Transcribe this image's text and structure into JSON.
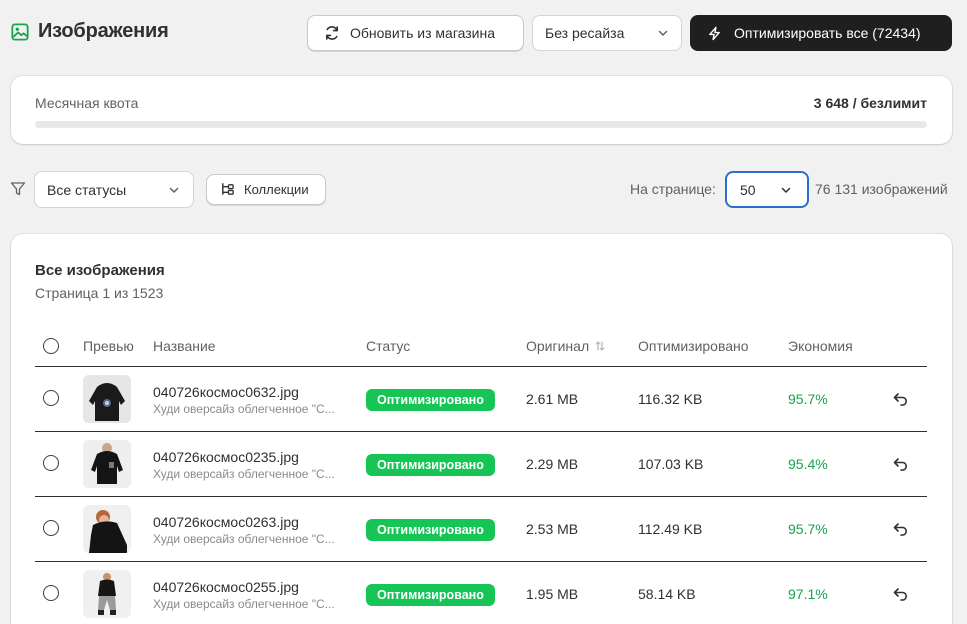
{
  "header": {
    "title": "Изображения",
    "refresh_label": "Обновить из магазина",
    "resize_value": "Без ресайза",
    "optimize_label": "Оптимизировать все (72434)"
  },
  "quota": {
    "label": "Месячная квота",
    "value": "3 648 / безлимит"
  },
  "filters": {
    "status_value": "Все статусы",
    "collections_label": "Коллекции",
    "per_page_label": "На странице:",
    "per_page_value": "50",
    "total_count": "76 131 изображений"
  },
  "table": {
    "title": "Все изображения",
    "subtitle": "Страница 1 из 1523",
    "columns": {
      "preview": "Превью",
      "name": "Название",
      "status": "Статус",
      "original": "Оригинал",
      "optimized": "Оптимизировано",
      "savings": "Экономия"
    },
    "rows": [
      {
        "name": "040726космос0632.jpg",
        "desc": "Худи оверсайз облегченное \"С...",
        "status": "Оптимизировано",
        "original": "2.61 MB",
        "optimized": "116.32 KB",
        "savings": "95.7%"
      },
      {
        "name": "040726космос0235.jpg",
        "desc": "Худи оверсайз облегченное \"С...",
        "status": "Оптимизировано",
        "original": "2.29 MB",
        "optimized": "107.03 KB",
        "savings": "95.4%"
      },
      {
        "name": "040726космос0263.jpg",
        "desc": "Худи оверсайз облегченное \"С...",
        "status": "Оптимизировано",
        "original": "2.53 MB",
        "optimized": "112.49 KB",
        "savings": "95.7%"
      },
      {
        "name": "040726космос0255.jpg",
        "desc": "Худи оверсайз облегченное \"С...",
        "status": "Оптимизировано",
        "original": "1.95 MB",
        "optimized": "58.14 KB",
        "savings": "97.1%"
      }
    ]
  },
  "icons": {
    "title": "image-icon",
    "refresh": "refresh-icon",
    "optimize": "lightning-icon",
    "filter": "filter-icon",
    "collections": "collections-icon",
    "sort": "sort-icon",
    "revert": "undo-icon"
  },
  "colors": {
    "accent_dark": "#1f1f1f",
    "status_green": "#16c556",
    "savings_green": "#16a34a",
    "title_icon_green": "#16a34a",
    "focus_blue": "#2c6ecb"
  }
}
